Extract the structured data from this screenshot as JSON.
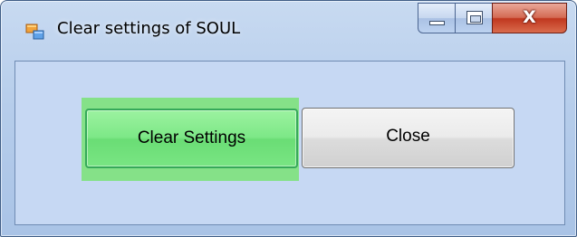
{
  "window": {
    "title": "Clear settings of SOUL",
    "app_icon": "app-window-icon",
    "caption_buttons": {
      "minimize_icon": "minimize-icon",
      "maximize_icon": "maximize-icon",
      "close_icon": "close-icon",
      "close_glyph": "X"
    }
  },
  "dialog": {
    "clear_settings_label": "Clear Settings",
    "close_label": "Close"
  },
  "colors": {
    "frame_border": "#3f5d86",
    "client_background": "#c6d8f3",
    "clear_button_green": "#7de887",
    "close_caption_red": "#c0371f"
  }
}
